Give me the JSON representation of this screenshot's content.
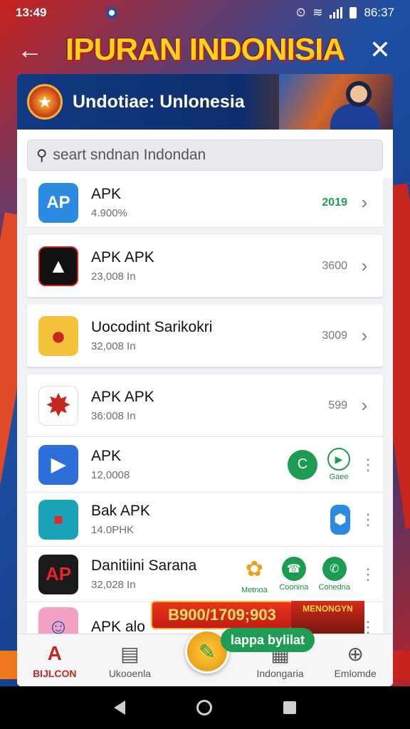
{
  "status_bar": {
    "time": "13:49",
    "right_text": "86:37"
  },
  "title_bar": {
    "title": "IPURAN INDONISIA",
    "back_glyph": "←",
    "close_glyph": "✕"
  },
  "banner": {
    "title": "Undotiae: Unlonesia",
    "logo_glyph": "★",
    "action_glyph": "↻"
  },
  "search": {
    "placeholder": "seart sndnan Indondan",
    "icon": "search-icon"
  },
  "apps": [
    {
      "icon_text": "AP",
      "icon_bg": "#2a8be0",
      "name": "APK",
      "sub": "4.900%",
      "count": "2019",
      "count_green": true,
      "trailing": "chevron"
    },
    {
      "icon_text": "▲",
      "icon_bg": "#111111",
      "name": "APK APK",
      "sub": "23,008 In",
      "count": "3600",
      "count_green": false,
      "trailing": "chevron"
    },
    {
      "icon_text": "●",
      "icon_bg": "#e9a11a",
      "name": "Uocodint Sarikokri",
      "sub": "32,008 In",
      "count": "3009",
      "count_green": false,
      "trailing": "chevron"
    },
    {
      "icon_text": "✸",
      "icon_bg": "#ffffff",
      "name": "APK APK",
      "sub": "36:008 In",
      "count": "599",
      "count_green": false,
      "trailing": "chevron"
    },
    {
      "icon_text": "▶",
      "icon_bg": "#2d6fd8",
      "name": "APK",
      "sub": "12,0008",
      "count": "",
      "count_green": false,
      "trailing": "actions"
    },
    {
      "icon_text": "■",
      "icon_bg": "#1aa3b8",
      "name": "Bak APK",
      "sub": "14.0PHK",
      "count": "",
      "count_green": false,
      "trailing": "actions"
    },
    {
      "icon_text": "AP",
      "icon_bg": "#1a1a1a",
      "name": "Danitiini Sarana",
      "sub": "32,028 In",
      "count": "",
      "count_green": false,
      "trailing": "actions"
    },
    {
      "icon_text": "☺",
      "icon_bg": "#f2a0c3",
      "name": "APK alo",
      "sub": "",
      "count": "",
      "count_green": false,
      "trailing": "kebab"
    }
  ],
  "row5_actions": {
    "primary": "C",
    "label": "Gaee"
  },
  "row6_actions": {
    "primary": "⬢"
  },
  "row7_actions": [
    {
      "glyph": "✿",
      "label": "Metnoa"
    },
    {
      "glyph": "☎",
      "label": "Coonina"
    },
    {
      "glyph": "✆",
      "label": "Conedna"
    }
  ],
  "promo": {
    "text": "B900/1709;903",
    "side_text": "MENONGYN"
  },
  "fab": {
    "tip": "lappa bylilat"
  },
  "bottom_nav": [
    {
      "glyph": "A",
      "label": "BIJLCON",
      "active": true
    },
    {
      "glyph": "▤",
      "label": "Ukooenla",
      "active": false
    },
    {
      "glyph": "",
      "label": "",
      "active": false
    },
    {
      "glyph": "▦",
      "label": "Indongaria",
      "active": false
    },
    {
      "glyph": "⊕",
      "label": "Emlomde",
      "active": false
    }
  ],
  "colors": {
    "accent_red": "#c7261f",
    "accent_blue": "#1d4fa3",
    "title_yellow": "#ffd21a",
    "green": "#1ca04b"
  }
}
